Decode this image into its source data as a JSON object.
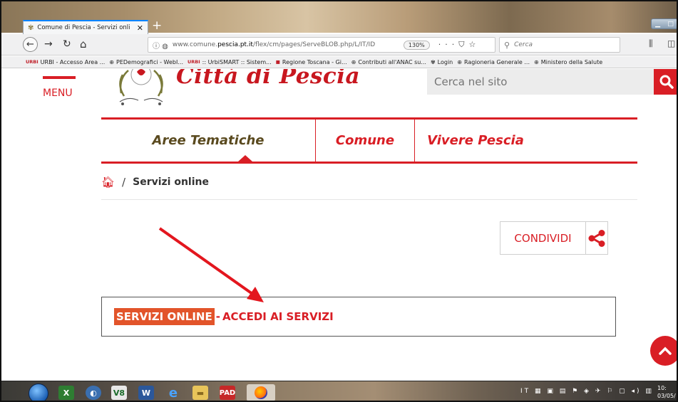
{
  "browser": {
    "tab_title": "Comune di Pescia - Servizi onli",
    "url_prefix": "www.comune.",
    "url_domain": "pescia.pt.it",
    "url_rest": "/flex/cm/pages/ServeBLOB.php/L/IT/ID",
    "zoom": "130%",
    "search_placeholder": "Cerca",
    "bookmarks": [
      "URBI - Accesso Area ...",
      "PEDemografici - WebI...",
      ":: UrbiSMART :: Sistem...",
      "Regione Toscana - Gi...",
      "Contributi all'ANAC su...",
      "Login",
      "Ragioneria Generale ...",
      "Ministero della Salute"
    ]
  },
  "site": {
    "menu_label": "MENU",
    "title": "Città di Pescia",
    "search_placeholder": "Cerca nel sito",
    "nav": [
      "Aree Tematiche",
      "Comune",
      "Vivere Pescia"
    ],
    "breadcrumb_sep": "/",
    "breadcrumb_current": "Servizi online",
    "share_label": "CONDIVIDI",
    "services_highlight": "SERVIZI ONLINE",
    "services_sep": "-",
    "services_link": "ACCEDI AI SERVIZI"
  },
  "taskbar": {
    "lang": "IT",
    "time": "10:",
    "date": "03/05/"
  },
  "colors": {
    "brand_red": "#d91e25",
    "highlight_orange": "#e2542a",
    "nav_dark": "#5a4a1f"
  }
}
